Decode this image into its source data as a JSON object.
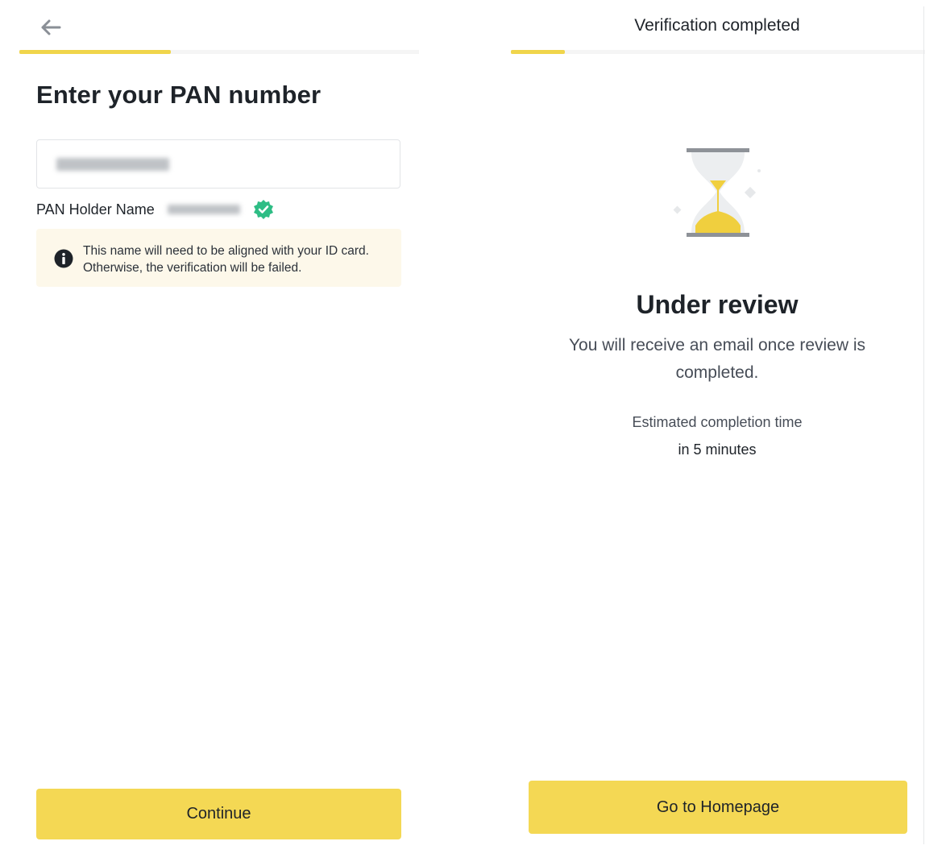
{
  "left_screen": {
    "back_icon": "arrow-left-icon",
    "progress_fraction": 0.38,
    "title": "Enter your PAN number",
    "pan_input": {
      "value_redacted": true
    },
    "holder_label": "PAN Holder Name",
    "holder_value_redacted": true,
    "verified_icon": "check-badge-icon",
    "notice": {
      "icon": "info-icon",
      "text": "This name will need to be aligned with your ID card. Otherwise, the verification will be failed."
    },
    "continue_label": "Continue"
  },
  "right_screen": {
    "header_title": "Verification completed",
    "progress_fraction": 0.13,
    "illustration_icon": "hourglass-icon",
    "status_title": "Under review",
    "status_description": "You will receive an email once review is completed.",
    "eta_label": "Estimated completion time",
    "eta_value": "in 5 minutes",
    "home_button_label": "Go to Homepage"
  },
  "colors": {
    "accent_yellow": "#F0D54B",
    "button_yellow": "#F4D854",
    "notice_bg": "#FDF8EA",
    "verified_green": "#2EBD85",
    "text_primary": "#1E2329",
    "text_secondary": "#474D57"
  }
}
